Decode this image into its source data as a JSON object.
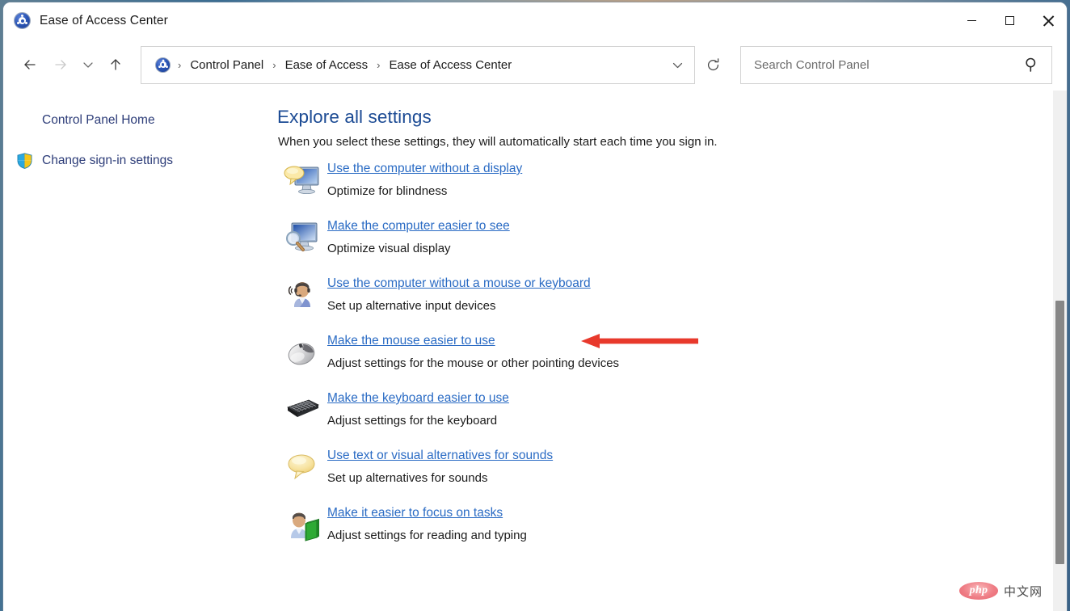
{
  "window": {
    "title": "Ease of Access Center",
    "icon": "ease-of-access-icon",
    "controls": {
      "minimize": "Minimize",
      "maximize": "Maximize",
      "close": "Close"
    }
  },
  "nav": {
    "back": "Back",
    "forward": "Forward",
    "recent": "Recent locations",
    "up": "Up",
    "refresh": "Refresh",
    "breadcrumbs": [
      "Control Panel",
      "Ease of Access",
      "Ease of Access Center"
    ],
    "separator": "›",
    "dropdown": "Previous locations"
  },
  "search": {
    "placeholder": "Search Control Panel",
    "value": "",
    "icon": "search-icon"
  },
  "sidebar": {
    "items": [
      {
        "label": "Control Panel Home",
        "icon": null
      },
      {
        "label": "Change sign-in settings",
        "icon": "shield-icon"
      }
    ]
  },
  "main": {
    "title": "Explore all settings",
    "subtitle": "When you select these settings, they will automatically start each time you sign in.",
    "settings": [
      {
        "link": "Use the computer without a display",
        "desc": "Optimize for blindness",
        "icon": "monitor-speech-icon"
      },
      {
        "link": "Make the computer easier to see",
        "desc": "Optimize visual display",
        "icon": "monitor-magnifier-icon"
      },
      {
        "link": "Use the computer without a mouse or keyboard",
        "desc": "Set up alternative input devices",
        "icon": "person-headset-icon"
      },
      {
        "link": "Make the mouse easier to use",
        "desc": "Adjust settings for the mouse or other pointing devices",
        "icon": "mouse-icon",
        "annotated": true
      },
      {
        "link": "Make the keyboard easier to use",
        "desc": "Adjust settings for the keyboard",
        "icon": "keyboard-icon"
      },
      {
        "link": "Use text or visual alternatives for sounds",
        "desc": "Set up alternatives for sounds",
        "icon": "speech-bubble-icon"
      },
      {
        "link": "Make it easier to focus on tasks",
        "desc": "Adjust settings for reading and typing",
        "icon": "person-book-icon"
      }
    ]
  },
  "annotation": {
    "type": "arrow-left",
    "color": "#e8392c",
    "points_at": "Make the mouse easier to use"
  },
  "watermark": {
    "brand": "php",
    "suffix": "中文网"
  },
  "scrollbar": {
    "orientation": "vertical",
    "visible": true
  },
  "colors": {
    "link": "#2a6bc4",
    "heading": "#1c4b94",
    "sidebar_link": "#2c3c78",
    "text": "#1b1b1b",
    "annotation": "#e8392c",
    "window_bg": "#ffffff"
  }
}
